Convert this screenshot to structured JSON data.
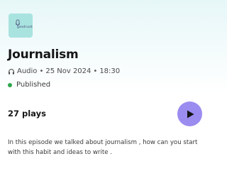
{
  "episode": {
    "cover_text": "podcast",
    "title": "Journalism",
    "type_label": "Audio",
    "separator": "•",
    "date": "25 Nov 2024",
    "time": "18:30",
    "status": "Published",
    "plays": "27 plays",
    "description": "In this episode we talked about journalism , how can you start with this habit and ideas to write ."
  },
  "icons": {
    "meta": "headphones-icon",
    "status": "status-dot-icon",
    "play": "play-icon"
  },
  "colors": {
    "cover_background": "#a9e3df",
    "status_green": "#2fa64a",
    "play_button": "#9b8cf0"
  }
}
